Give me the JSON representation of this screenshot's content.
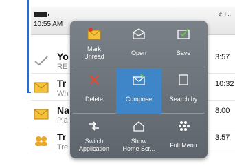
{
  "status": {
    "time": "10:55 AM",
    "signal": "ⅇ T..."
  },
  "messages": [
    {
      "name": "Yo",
      "preview": "RE",
      "time": "3:57",
      "icon": "checkmark-icon"
    },
    {
      "name": "Tr",
      "preview": "Wh",
      "time": "10:32",
      "icon": "envelope-icon"
    },
    {
      "name": "Na",
      "preview": "Pla",
      "time": "8:00",
      "icon": "envelope-icon"
    },
    {
      "name": "Tr",
      "preview": "Tre",
      "time": "3:57",
      "icon": "contacts-icon"
    }
  ],
  "menu": [
    {
      "label": "Mark\nUnread",
      "icon": "mark-unread-icon"
    },
    {
      "label": "Open",
      "icon": "open-envelope-icon"
    },
    {
      "label": "Save",
      "icon": "save-icon"
    },
    {
      "label": "Delete",
      "icon": "delete-icon"
    },
    {
      "label": "Compose",
      "icon": "compose-icon",
      "selected": true
    },
    {
      "label": "Search by",
      "icon": "search-by-icon"
    },
    {
      "label": "Switch\nApplication",
      "icon": "switch-application-icon"
    },
    {
      "label": "Show\nHome Scr...",
      "icon": "home-icon"
    },
    {
      "label": "Full Menu",
      "icon": "full-menu-icon"
    }
  ],
  "colors": {
    "accent": "#3f86c8",
    "callout": "#1e6fd6",
    "menu_bg": "#6a7178"
  }
}
